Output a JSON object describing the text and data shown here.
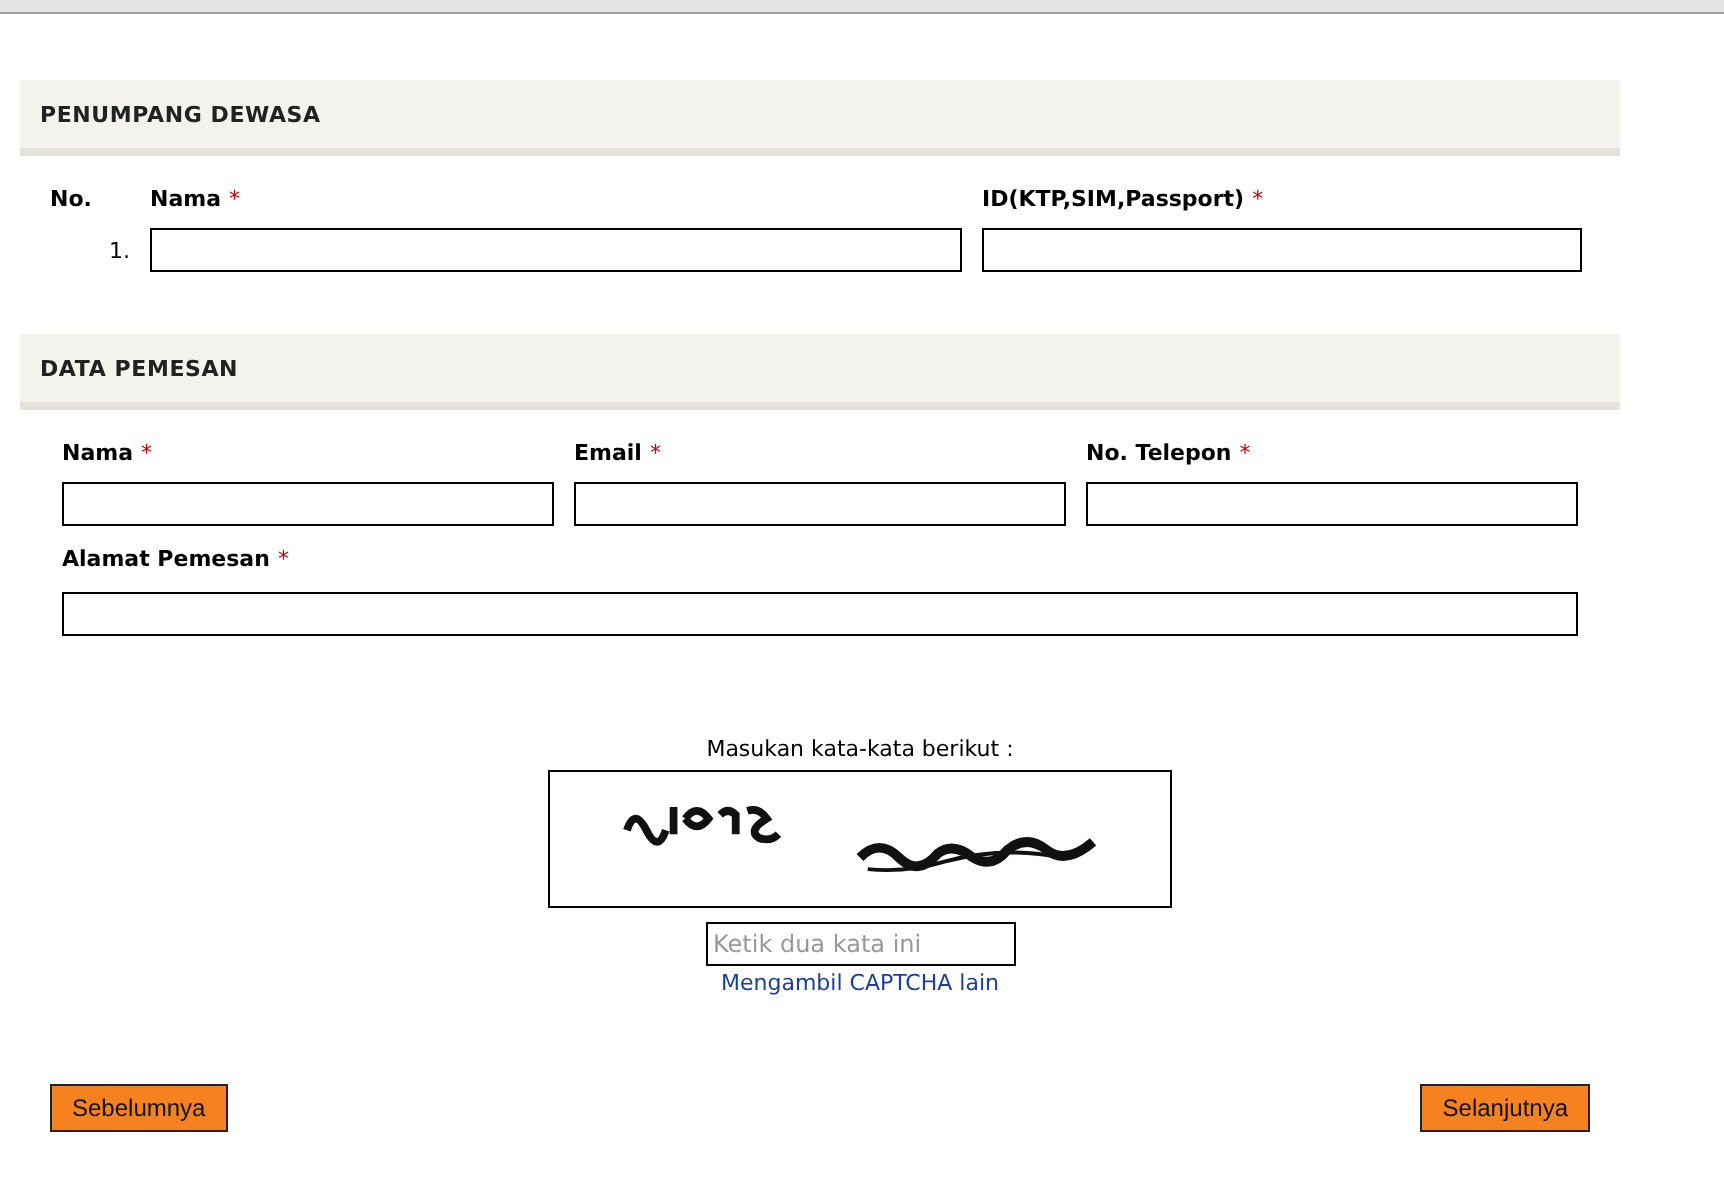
{
  "passengers": {
    "title": "PENUMPANG DEWASA",
    "columns": [
      {
        "label": "No."
      },
      {
        "label": "Nama",
        "marker": "*"
      },
      {
        "label": "ID(KTP,SIM,Passport)",
        "marker": "*"
      }
    ],
    "rows": [
      {
        "number": "1."
      }
    ]
  },
  "booker": {
    "title": "DATA PEMESAN",
    "fields": [
      {
        "label": "Nama",
        "marker": "*"
      },
      {
        "label": "Email",
        "marker": "*"
      },
      {
        "label": "No. Telepon",
        "marker": "*"
      }
    ],
    "address": {
      "label": "Alamat Pemesan",
      "marker": "*"
    }
  },
  "captcha": {
    "prompt": "Masukan kata-kata berikut :",
    "input": {
      "placeholder": "Ketik dua kata ini"
    },
    "reload_link": "Mengambil CAPTCHA lain"
  },
  "buttons": {
    "previous": "Sebelumnya",
    "next": "Selanjutnya"
  }
}
